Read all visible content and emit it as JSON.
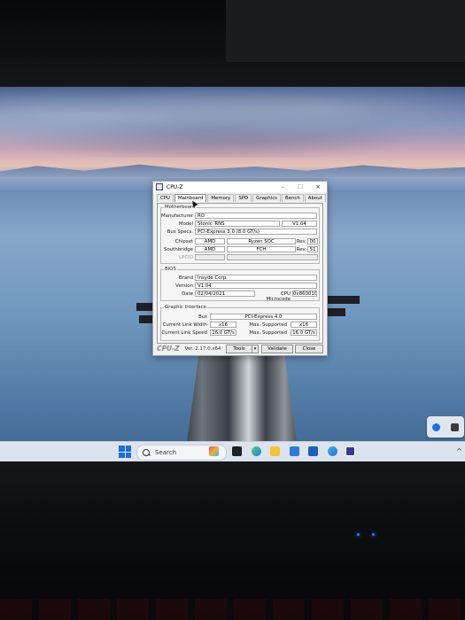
{
  "window": {
    "title": "CPU-Z",
    "controls": [
      "–",
      "☐",
      "✕"
    ]
  },
  "tabs": [
    "CPU",
    "Mainboard",
    "Memory",
    "SPD",
    "Graphics",
    "Bench",
    "About"
  ],
  "active_tab": "Mainboard",
  "motherboard": {
    "group_label": "Motherboard",
    "manufacturer_label": "Manufacturer",
    "manufacturer": "RO",
    "model_label": "Model",
    "model": "Stonic_RNS",
    "model_rev": "V1.04",
    "bus_specs_label": "Bus Specs.",
    "bus_specs": "PCI-Express 3.0 (8.0 GT/s)",
    "chipset_label": "Chipset",
    "chipset_vendor": "AMD",
    "chipset_name": "Ryzen SOC",
    "chipset_rev_label": "Rev.",
    "chipset_rev": "00",
    "southbridge_label": "Southbridge",
    "southbridge_vendor": "AMD",
    "southbridge_name": "FCH",
    "southbridge_rev_label": "Rev.",
    "southbridge_rev": "51",
    "lpcio_label": "LPCIO"
  },
  "bios": {
    "group_label": "BIOS",
    "brand_label": "Brand",
    "brand": "Insyde Corp.",
    "version_label": "Version",
    "version": "V1.04",
    "date_label": "Date",
    "date": "02/04/2021",
    "microcode_label": "CPU Microcode",
    "microcode": "0x8600103"
  },
  "graphic_interface": {
    "group_label": "Graphic Interface",
    "bus_label": "Bus",
    "bus": "PCI-Express 4.0",
    "link_width_label": "Current Link Width",
    "link_width": "x16",
    "max_width_label": "Max. Supported",
    "max_width": "x16",
    "link_speed_label": "Current Link Speed",
    "link_speed": "16.0 GT/s",
    "max_speed_label": "Max. Supported",
    "max_speed": "16.0 GT/s"
  },
  "footer": {
    "brand": "CPU-Z",
    "version": "Ver. 2.17.0.x64",
    "tools_label": "Tools",
    "validate_label": "Validate",
    "close_label": "Close"
  },
  "taskbar": {
    "search_placeholder": "Search",
    "icons": [
      "start-icon",
      "search-icon",
      "copilot-icon",
      "task-view-icon",
      "edge-icon",
      "file-explorer-icon",
      "store-icon",
      "mail-icon",
      "browser-icon",
      "cpuz-icon"
    ],
    "overflow_chevron": "^"
  },
  "colors": {
    "taskbar_bg": "#dde3ec",
    "window_bg": "#f0f0f0",
    "accent": "#1b6fd8"
  }
}
